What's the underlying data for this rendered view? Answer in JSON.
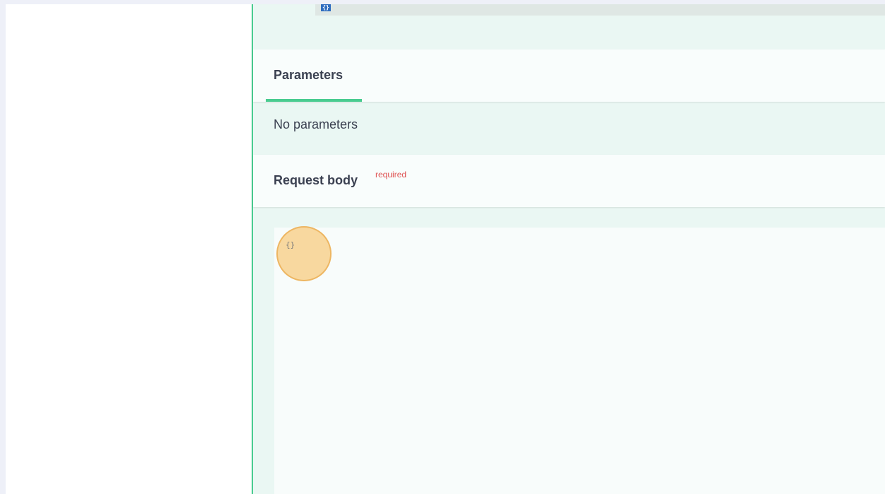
{
  "top_code": {
    "icon": "code-icon",
    "glyph": "{}"
  },
  "parameters": {
    "tab_label": "Parameters",
    "empty_text": "No parameters"
  },
  "request_body": {
    "title": "Request body",
    "required_label": "required",
    "editor_value": "{}"
  },
  "colors": {
    "accent": "#49cc90",
    "panel_bg": "#eaf7f3",
    "required": "#e05a5a",
    "text": "#3b4151",
    "click_marker": "#f8cc80"
  }
}
